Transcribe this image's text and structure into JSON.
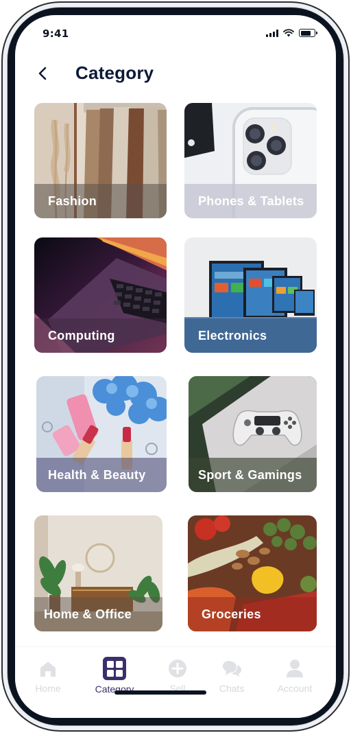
{
  "status_bar": {
    "time": "9:41"
  },
  "header": {
    "title": "Category",
    "back_icon": "chevron-left-icon"
  },
  "categories": [
    {
      "label": "Fashion"
    },
    {
      "label": "Phones & Tablets"
    },
    {
      "label": "Computing"
    },
    {
      "label": "Electronics"
    },
    {
      "label": "Health & Beauty"
    },
    {
      "label": "Sport & Gamings"
    },
    {
      "label": "Home & Office"
    },
    {
      "label": "Groceries"
    }
  ],
  "tabbar": {
    "items": [
      {
        "label": "Home",
        "icon": "home-icon",
        "active": false
      },
      {
        "label": "Category",
        "icon": "category-grid-icon",
        "active": true
      },
      {
        "label": "Sell",
        "icon": "plus-circle-icon",
        "active": false
      },
      {
        "label": "Chats",
        "icon": "chat-bubbles-icon",
        "active": false
      },
      {
        "label": "Account",
        "icon": "person-icon",
        "active": false
      }
    ]
  },
  "colors": {
    "accent": "#3b2f6b",
    "title": "#0c1a36",
    "inactive_tab": "#d6d8dc"
  }
}
